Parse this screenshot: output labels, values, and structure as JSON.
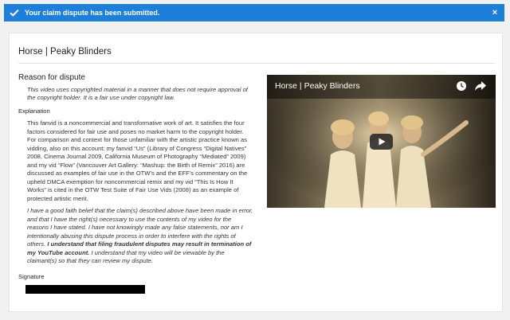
{
  "banner": {
    "message": "Your claim dispute has been submitted.",
    "close_glyph": "×",
    "color": "#1e7fd8"
  },
  "card": {
    "title": "Horse | Peaky Blinders"
  },
  "dispute": {
    "reason_heading": "Reason for dispute",
    "reason_text": "This video uses copyrighted material in a manner that does not require approval of the copyright holder. It is a fair use under copyright law.",
    "explanation_label": "Explanation",
    "explanation_text": "This fanvid is a noncommercial and transformative work of art. It satisfies the four factors considered for fair use and poses no market harm to the copyright holder. For comparison and context for those unfamiliar with the artistic practice known as vidding, also on this account: my fanvid “Us” (Library of Congress “Digital Natives” 2008, Cinema Journal 2009, California Museum of Photography “Mediated” 2009) and my vid “Flow” (Vancouver Art Gallery: “Mashup: the Birth of Remix” 2016) are discussed as examples of fair use in the OTW’s and the EFF’s commentary on the upheld DMCA exemption for noncommercial remix and my vid “This Is How It Works” is cited in the OTW Test Suite of Fair Use Vids (2008) as an example of protected artistic merit.",
    "affirm_part1": "I have a good faith belief that the claim(s) described above have been made in error, and that I have the right(s) necessary to use the contents of my video for the reasons I have stated. I have not knowingly made any false statements, nor am I intentionally abusing this dispute process in order to interfere with the rights of others.",
    "affirm_bold": "I understand that filing fraudulent disputes may result in termination of my YouTube account.",
    "affirm_part2": "I understand that my video will be viewable by the claimant(s) so that they can review my dispute.",
    "signature_label": "Signature"
  },
  "video": {
    "title": "Horse | Peaky Blinders",
    "icons": [
      "watch-later-icon",
      "share-icon",
      "play-icon"
    ]
  }
}
